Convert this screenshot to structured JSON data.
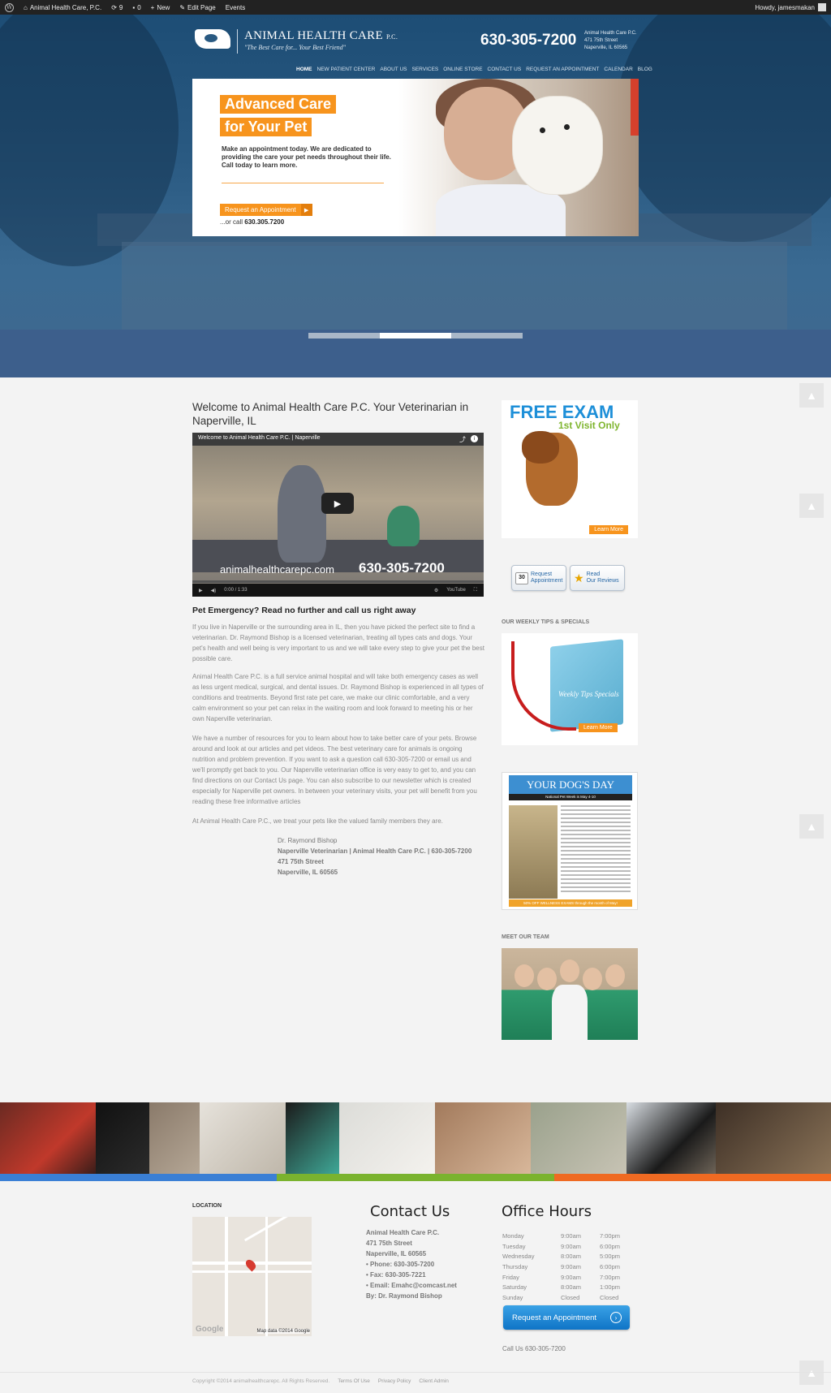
{
  "admin_bar": {
    "site_name": "Animal Health Care, P.C.",
    "updates_count": "9",
    "comments_count": "0",
    "new_label": "New",
    "edit_label": "Edit Page",
    "events_label": "Events",
    "howdy": "Howdy, jamesmakan"
  },
  "header": {
    "logo_name": "ANIMAL HEALTH CARE",
    "logo_suffix": "P.C.",
    "tagline": "\"The Best Care for... Your Best Friend\"",
    "phone": "630-305-7200",
    "address": [
      "Animal Health Care P.C.",
      "471 75th Street",
      "Naperville, IL 60565"
    ],
    "nav": [
      "HOME",
      "NEW PATIENT CENTER",
      "ABOUT US",
      "SERVICES",
      "ONLINE STORE",
      "CONTACT US",
      "REQUEST AN APPOINTMENT",
      "CALENDAR",
      "BLOG"
    ]
  },
  "slide": {
    "headline1": "Advanced Care",
    "headline2": "for Your Pet",
    "description": "Make an appointment today. We are dedicated to providing the care your pet needs throughout their life. Call today to learn more.",
    "button_label": "Request an Appointment",
    "or_call": "...or call",
    "or_call_number": "630.305.7200",
    "active_dot": 1,
    "dot_count": 3
  },
  "main": {
    "welcome_title": "Welcome to Animal Health Care P.C. Your Veterinarian in Naperville, IL",
    "video": {
      "title": "Welcome to Animal Health Care P.C. | Naperville",
      "url_text": "animalhealthcarepc.com",
      "phone_text": "630-305-7200",
      "time": "0:00 / 1:33",
      "youtube": "YouTube"
    },
    "emergency_heading": "Pet Emergency? Read no further and call us right away",
    "paragraphs": [
      "If you live in Naperville or the surrounding area in IL, then you have picked the perfect site to find a veterinarian. Dr. Raymond Bishop is a licensed veterinarian, treating all types cats and dogs. Your pet's health and well being is very important to us and we will take every step to give your pet the best possible care.",
      "Animal Health Care P.C. is a full service animal hospital and will take both emergency cases as well as less urgent medical, surgical, and dental issues. Dr. Raymond Bishop is experienced in all types of conditions and treatments. Beyond first rate pet care, we make our clinic comfortable, and a very calm environment so your pet can relax in the waiting room and look forward to meeting his or her own Naperville veterinarian.",
      "We have a number of resources for you to learn about how to take better care of your pets. Browse around and look at our articles and pet videos. The best veterinary care for animals is ongoing nutrition and problem prevention. If you want to ask a question call 630-305-7200 or email us and we'll promptly get back to you. Our Naperville veterinarian office is very easy to get to, and you can find directions on our Contact Us page. You can also subscribe to our newsletter which is created especially for Naperville pet owners. In between your veterinary visits, your pet will benefit from you reading these free informative articles",
      "At Animal Health Care P.C., we treat your pets like the valued family members they are."
    ],
    "signature": [
      "Dr. Raymond Bishop",
      "Naperville Veterinarian | Animal Health Care P.C. | 630-305-7200",
      "471 75th Street",
      "Naperville, IL 60565"
    ]
  },
  "sidebar": {
    "free_exam_title": "FREE EXAM",
    "free_exam_sub": "1st Visit Only",
    "learn_more": "Learn More",
    "request_btn": [
      "Request",
      "Appointment"
    ],
    "request_icon": "30",
    "reviews_btn": [
      "Read",
      "Our Reviews"
    ],
    "tips_label": "OUR WEEKLY TIPS & SPECIALS",
    "tips_book": "Weekly Tips Specials",
    "dogday_title": "YOUR DOG'S DAY",
    "dogday_sub": "National Pet Week is May 4-10",
    "dogday_foot": "50% OFF WELLNESS EXAMS through the month of May!",
    "team_label": "MEET OUR TEAM"
  },
  "footer": {
    "location_label": "LOCATION",
    "map_logo": "Google",
    "map_data": "Map data ©2014 Google",
    "contact_title": "Contact Us",
    "contact_lines": [
      "Animal Health Care P.C.",
      "471 75th Street",
      "Naperville, IL 60565",
      "• Phone: 630-305-7200",
      "• Fax: 630-305-7221",
      "• Email: Emahc@comcast.net",
      "By: Dr. Raymond Bishop"
    ],
    "hours_title": "Office Hours",
    "hours": [
      {
        "day": "Monday",
        "open": "9:00am",
        "close": "7:00pm"
      },
      {
        "day": "Tuesday",
        "open": "9:00am",
        "close": "6:00pm"
      },
      {
        "day": "Wednesday",
        "open": "8:00am",
        "close": "5:00pm"
      },
      {
        "day": "Thursday",
        "open": "9:00am",
        "close": "6:00pm"
      },
      {
        "day": "Friday",
        "open": "9:00am",
        "close": "7:00pm"
      },
      {
        "day": "Saturday",
        "open": "8:00am",
        "close": "1:00pm"
      },
      {
        "day": "Sunday",
        "open": "Closed",
        "close": "Closed"
      }
    ],
    "appointment_btn": "Request an Appointment",
    "call_us": "Call Us 630-305-7200",
    "copyright": "Copyright ©2014 animalhealthcarepc. All Rights Reserved.",
    "links": [
      "Terms Of Use",
      "Privacy Policy",
      "Client Admin"
    ]
  },
  "colors": {
    "accent_orange": "#f7941d",
    "brand_blue": "#1d4d75",
    "bar_blue": "#3a7fd5",
    "bar_green": "#7ab32e",
    "bar_orange": "#ef6a22"
  }
}
